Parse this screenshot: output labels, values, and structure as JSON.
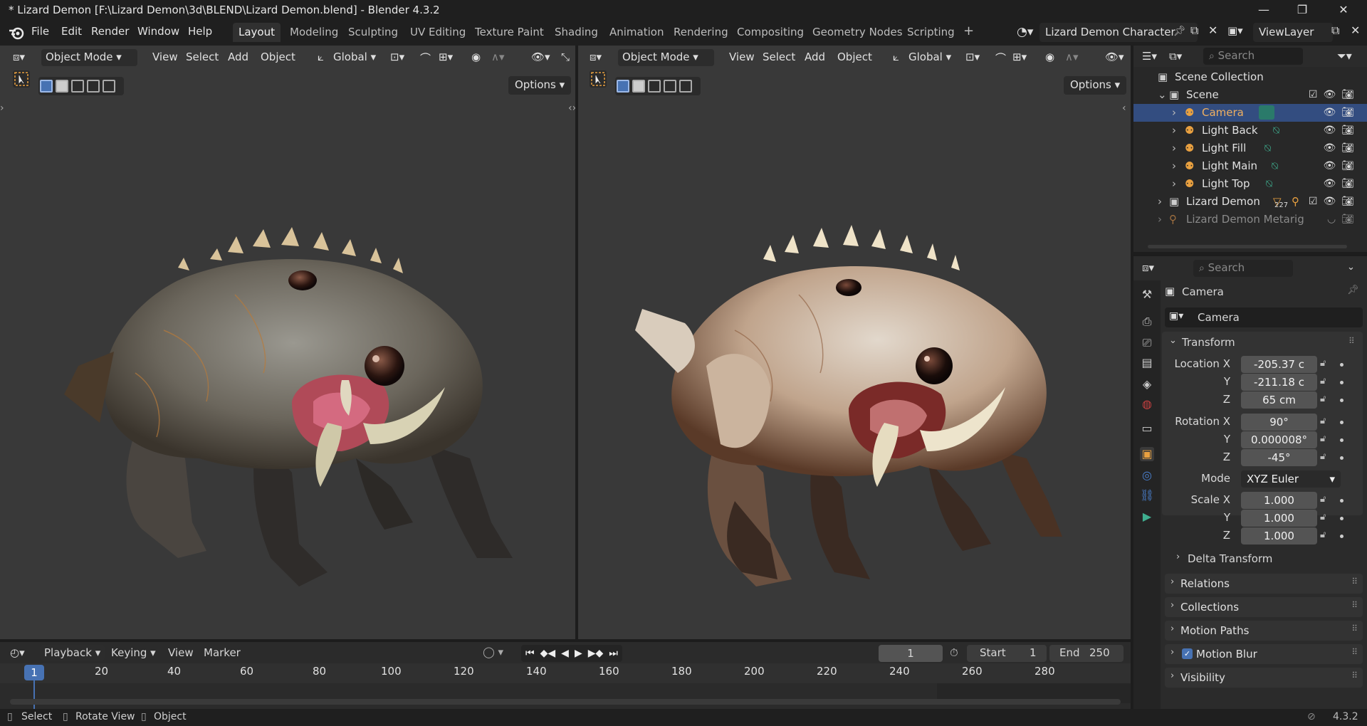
{
  "window": {
    "title": "* Lizard Demon [F:\\Lizard Demon\\3d\\BLEND\\Lizard Demon.blend] - Blender 4.3.2",
    "minimize": "—",
    "maximize": "❐",
    "close": "✕"
  },
  "menu": [
    "File",
    "Edit",
    "Render",
    "Window",
    "Help"
  ],
  "workspaces": [
    "Layout",
    "Modeling",
    "Sculpting",
    "UV Editing",
    "Texture Paint",
    "Shading",
    "Animation",
    "Rendering",
    "Compositing",
    "Geometry Nodes",
    "Scripting"
  ],
  "active_workspace": "Layout",
  "add_workspace": "+",
  "scene_name": "Lizard Demon Character",
  "view_layer": "ViewLayer",
  "viewport_left": {
    "mode": "Object Mode",
    "menus": [
      "View",
      "Select",
      "Add",
      "Object"
    ],
    "orientation": "Global",
    "options": "Options"
  },
  "viewport_right": {
    "mode": "Object Mode",
    "menus": [
      "View",
      "Select",
      "Add",
      "Object"
    ],
    "orientation": "Global",
    "options": "Options"
  },
  "outliner": {
    "search_placeholder": "Search",
    "rows": [
      {
        "label": "Scene Collection"
      },
      {
        "label": "Scene"
      },
      {
        "label": "Camera"
      },
      {
        "label": "Light Back"
      },
      {
        "label": "Light Fill"
      },
      {
        "label": "Light Main"
      },
      {
        "label": "Light Top"
      },
      {
        "label": "Lizard Demon",
        "badge": "227"
      },
      {
        "label": "Lizard Demon Metarig"
      }
    ]
  },
  "properties": {
    "search_placeholder": "Search",
    "object_name": "Camera",
    "data_name": "Camera",
    "transform_header": "Transform",
    "location_label": "Location X",
    "y_label": "Y",
    "z_label": "Z",
    "rotation_label": "Rotation X",
    "mode_label": "Mode",
    "scale_label": "Scale X",
    "location": [
      "-205.37 c",
      "-211.18 c",
      "65 cm"
    ],
    "rotation": [
      "90°",
      "0.000008°",
      "-45°"
    ],
    "rotation_mode": "XYZ Euler",
    "scale": [
      "1.000",
      "1.000",
      "1.000"
    ],
    "delta_transform": "Delta Transform",
    "panels": [
      "Relations",
      "Collections",
      "Motion Paths",
      "Motion Blur",
      "Visibility"
    ]
  },
  "timeline": {
    "menus": [
      "Playback",
      "Keying",
      "View",
      "Marker"
    ],
    "current_frame": "1",
    "start_label": "Start",
    "start": "1",
    "end_label": "End",
    "end": "250",
    "ticks": [
      "1",
      "20",
      "40",
      "60",
      "80",
      "100",
      "120",
      "140",
      "160",
      "180",
      "200",
      "220",
      "240",
      "260",
      "280"
    ]
  },
  "statusbar": {
    "select": "Select",
    "rotate_view": "Rotate View",
    "object": "Object",
    "version": "4.3.2"
  },
  "colors": {
    "accent_blue": "#4772b3",
    "selected_row": "#334d80",
    "camera_orange": "#e8a040",
    "light_green": "#3fae8f"
  }
}
